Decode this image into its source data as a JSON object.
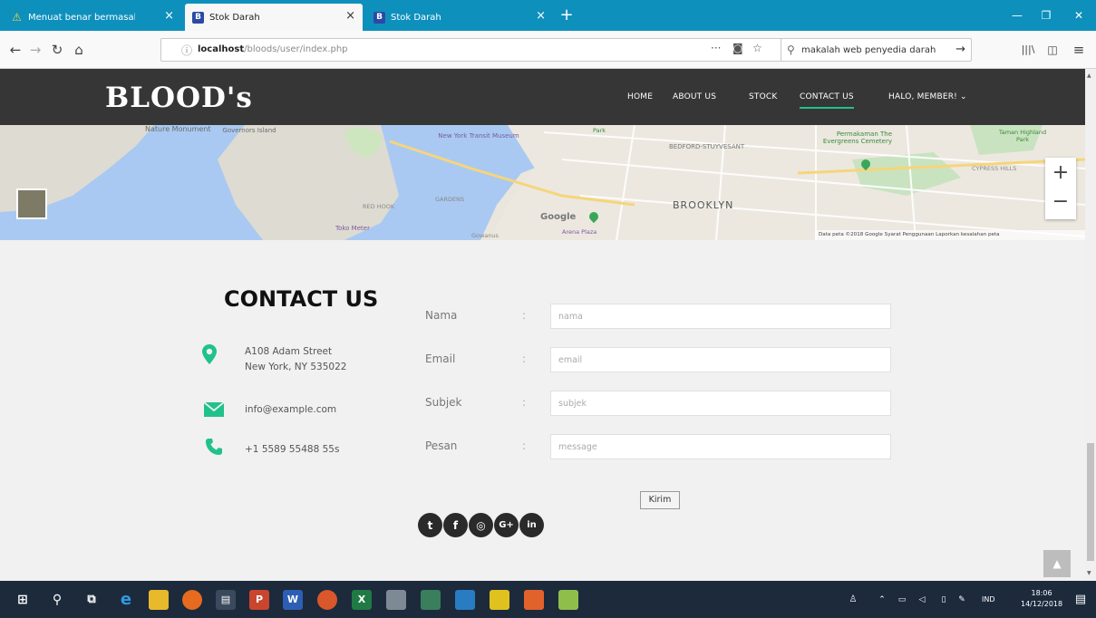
{
  "browser": {
    "tabs": [
      {
        "label": "Menuat benar bermasalah",
        "icon": "warning-icon"
      },
      {
        "label": "Stok Darah",
        "icon": "b-favicon-icon"
      },
      {
        "label": "Stok Darah",
        "icon": "b-favicon-icon"
      }
    ],
    "url_host": "localhost",
    "url_path": "/bloods/user/index.php",
    "search_query": "makalah web penyedia darah"
  },
  "site": {
    "logo": "BLOOD's",
    "menu": [
      "HOME",
      "ABOUT US",
      "STOCK",
      "CONTACT US",
      "HALO, MEMBER! ⌄"
    ],
    "active_menu": "CONTACT US",
    "accent_color": "#1fc28a"
  },
  "map": {
    "labels": [
      "Nature Monument",
      "Governors Island",
      "New York Transit Museum",
      "BEDFORD-STUYVESANT",
      "Permakaman The Evergreens Cemetery",
      "CYPRESS HILLS",
      "Taman Highland Park",
      "RED HOOK",
      "GARDENS",
      "BROOKLYN",
      "Toko Meter",
      "Gowanus",
      "Arena Plaza",
      "Park"
    ],
    "footer": "Data peta ©2018 Google   Syarat Penggunaan   Laporkan kesalahan peta"
  },
  "contact": {
    "title": "CONTACT US",
    "address_line1": "A108 Adam Street",
    "address_line2": "New York, NY 535022",
    "email": "info@example.com",
    "phone": "+1 5589 55488 55s",
    "fields": [
      {
        "label": "Nama",
        "placeholder": "nama"
      },
      {
        "label": "Email",
        "placeholder": "email"
      },
      {
        "label": "Subjek",
        "placeholder": "subjek"
      },
      {
        "label": "Pesan",
        "placeholder": "message"
      }
    ],
    "submit": "Kirim",
    "social": [
      "twitter-icon",
      "facebook-icon",
      "instagram-icon",
      "google-plus-icon",
      "linkedin-icon"
    ]
  },
  "taskbar": {
    "lang": "IND",
    "time": "18:06",
    "date": "14/12/2018"
  }
}
